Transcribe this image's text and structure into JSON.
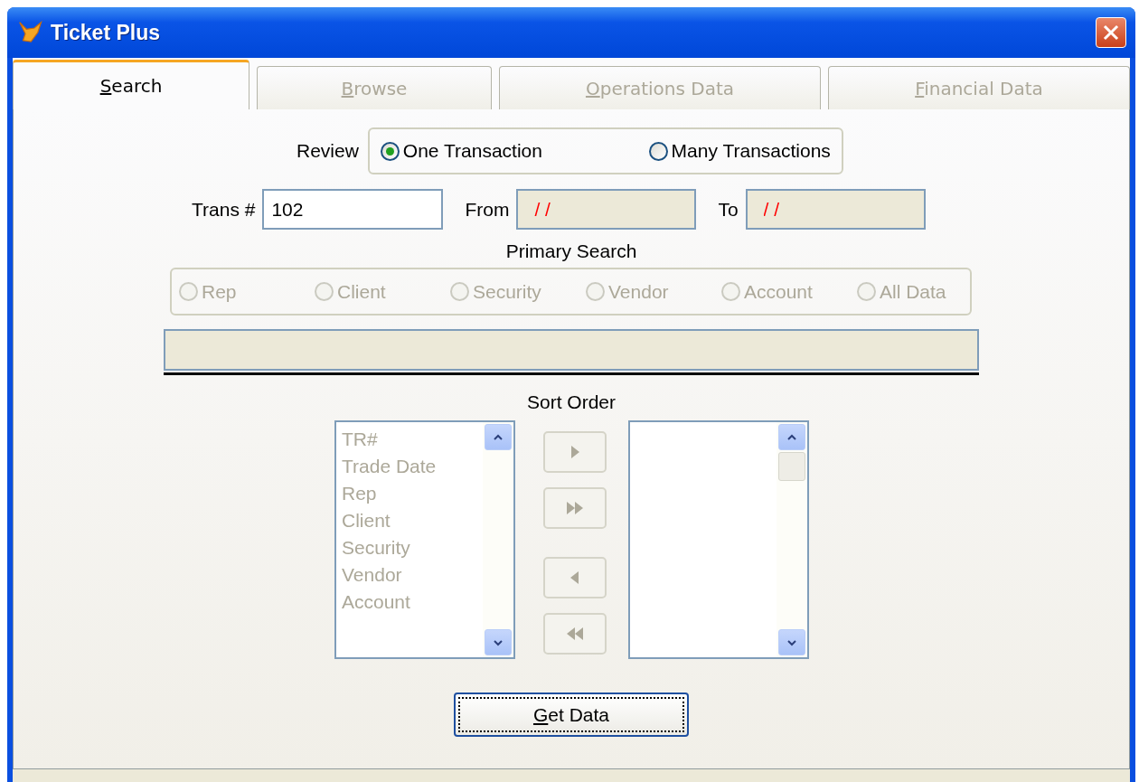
{
  "window": {
    "title": "Ticket Plus"
  },
  "tabs": [
    {
      "key": "S",
      "rest": "earch",
      "selected": true,
      "disabled": false
    },
    {
      "key": "B",
      "rest": "rowse",
      "selected": false,
      "disabled": true
    },
    {
      "key": "O",
      "rest": "perations Data",
      "selected": false,
      "disabled": true
    },
    {
      "key": "F",
      "rest": "inancial Data",
      "selected": false,
      "disabled": true
    }
  ],
  "review": {
    "label": "Review",
    "options": [
      {
        "label": "One Transaction",
        "selected": true
      },
      {
        "label": "Many Transactions",
        "selected": false
      }
    ]
  },
  "trans": {
    "label": "Trans #",
    "value": "102"
  },
  "from": {
    "label": "From",
    "value": "/ /",
    "disabled": true
  },
  "to": {
    "label": "To",
    "value": "/ /",
    "disabled": true
  },
  "primary_search": {
    "label": "Primary Search",
    "disabled": true,
    "options": [
      {
        "label": "Rep",
        "selected": false
      },
      {
        "label": "Client",
        "selected": false
      },
      {
        "label": "Security",
        "selected": false
      },
      {
        "label": "Vendor",
        "selected": false
      },
      {
        "label": "Account",
        "selected": false
      },
      {
        "label": "All Data",
        "selected": false
      }
    ]
  },
  "sort_order": {
    "label": "Sort Order",
    "available": {
      "disabled": true,
      "items": [
        "TR#",
        "Trade Date",
        "Rep",
        "Client",
        "Security",
        "Vendor",
        "Account"
      ]
    },
    "move_buttons": [
      {
        "kind": "one-right",
        "disabled": true
      },
      {
        "kind": "all-right",
        "disabled": true
      },
      {
        "kind": "one-left",
        "disabled": true
      },
      {
        "kind": "all-left",
        "disabled": true
      }
    ]
  },
  "get_data": {
    "key": "G",
    "rest": "et Data"
  }
}
